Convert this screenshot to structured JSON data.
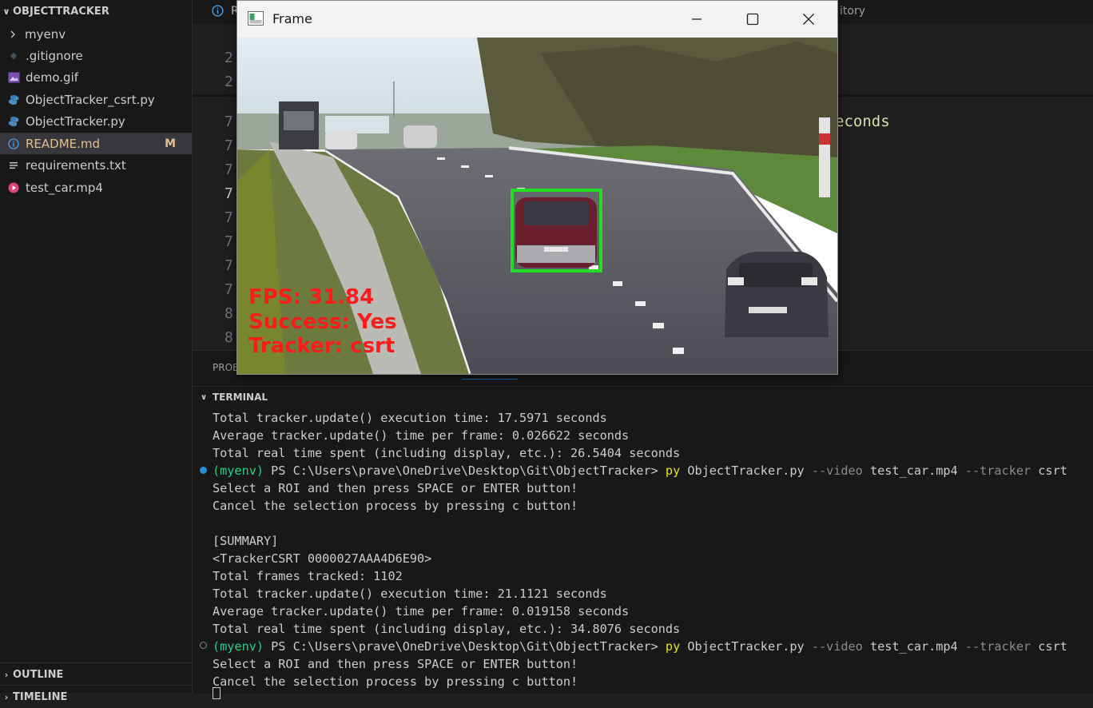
{
  "sidebar": {
    "section_title": "OBJECTTRACKER",
    "items": [
      {
        "label": "myenv",
        "icon": "chevron-right-icon",
        "badge": ""
      },
      {
        "label": ".gitignore",
        "icon": "git-diamond-icon",
        "badge": ""
      },
      {
        "label": "demo.gif",
        "icon": "image-icon",
        "badge": ""
      },
      {
        "label": "ObjectTracker_csrt.py",
        "icon": "python-icon",
        "badge": ""
      },
      {
        "label": "ObjectTracker.py",
        "icon": "python-icon",
        "badge": ""
      },
      {
        "label": "README.md",
        "icon": "info-icon",
        "badge": "M"
      },
      {
        "label": "requirements.txt",
        "icon": "text-lines-icon",
        "badge": ""
      },
      {
        "label": "test_car.mp4",
        "icon": "play-icon",
        "badge": ""
      }
    ],
    "outline": "OUTLINE",
    "timeline": "TIMELINE"
  },
  "editor": {
    "tab_fragment_left": "R",
    "tab_fragment_right": "itory",
    "line_numbers": [
      "2",
      "2",
      "7",
      "7",
      "7",
      "7",
      "7",
      "7",
      "7",
      "7",
      "8",
      "8"
    ],
    "code_fragment": "econds"
  },
  "panel": {
    "tab_fragment": "PROB",
    "terminal_label": "TERMINAL",
    "lines": [
      {
        "text": "Total tracker.update() execution time: 17.5971 seconds"
      },
      {
        "text": "Average tracker.update() time per frame: 0.026622 seconds"
      },
      {
        "text": "Total real time spent (including display, etc.): 26.5404 seconds"
      },
      {
        "prompt": true,
        "env": "(myenv)",
        "ps": " PS C:\\Users\\prave\\OneDrive\\Desktop\\Git\\ObjectTracker> ",
        "cmd": "py",
        "script": " ObjectTracker.py ",
        "flag1": "--video",
        "arg1": " test_car.mp4 ",
        "flag2": "--tracker",
        "arg2": " csrt"
      },
      {
        "text": "Select a ROI and then press SPACE or ENTER button!"
      },
      {
        "text": "Cancel the selection process by pressing c button!"
      },
      {
        "text": ""
      },
      {
        "text": "[SUMMARY]"
      },
      {
        "text": "<TrackerCSRT 0000027AAA4D6E90>"
      },
      {
        "text": "Total frames tracked: 1102"
      },
      {
        "text": "Total tracker.update() execution time: 21.1121 seconds"
      },
      {
        "text": "Average tracker.update() time per frame: 0.019158 seconds"
      },
      {
        "text": "Total real time spent (including display, etc.): 34.8076 seconds"
      },
      {
        "prompt": true,
        "env": "(myenv)",
        "ps": " PS C:\\Users\\prave\\OneDrive\\Desktop\\Git\\ObjectTracker> ",
        "cmd": "py",
        "script": " ObjectTracker.py ",
        "flag1": "--video",
        "arg1": " test_car.mp4 ",
        "flag2": "--tracker",
        "arg2": " csrt"
      },
      {
        "text": "Select a ROI and then press SPACE or ENTER button!"
      },
      {
        "text": "Cancel the selection process by pressing c button!"
      }
    ]
  },
  "frame_window": {
    "title": "Frame",
    "overlay": {
      "fps": "FPS: 31.84",
      "success": "Success: Yes",
      "tracker": "Tracker: csrt"
    },
    "colors": {
      "overlay_text": "#ff1a1a",
      "bbox": "#22dd22"
    }
  },
  "colors": {
    "sidebar_bg": "#181818",
    "editor_bg": "#1f1f1f",
    "selected_item": "#37373d",
    "modified_badge": "#e2c08d",
    "terminal_env": "#23d18b",
    "terminal_cmd": "#e5e510",
    "terminal_flag": "#8b8b8b",
    "accent": "#0078d4"
  }
}
